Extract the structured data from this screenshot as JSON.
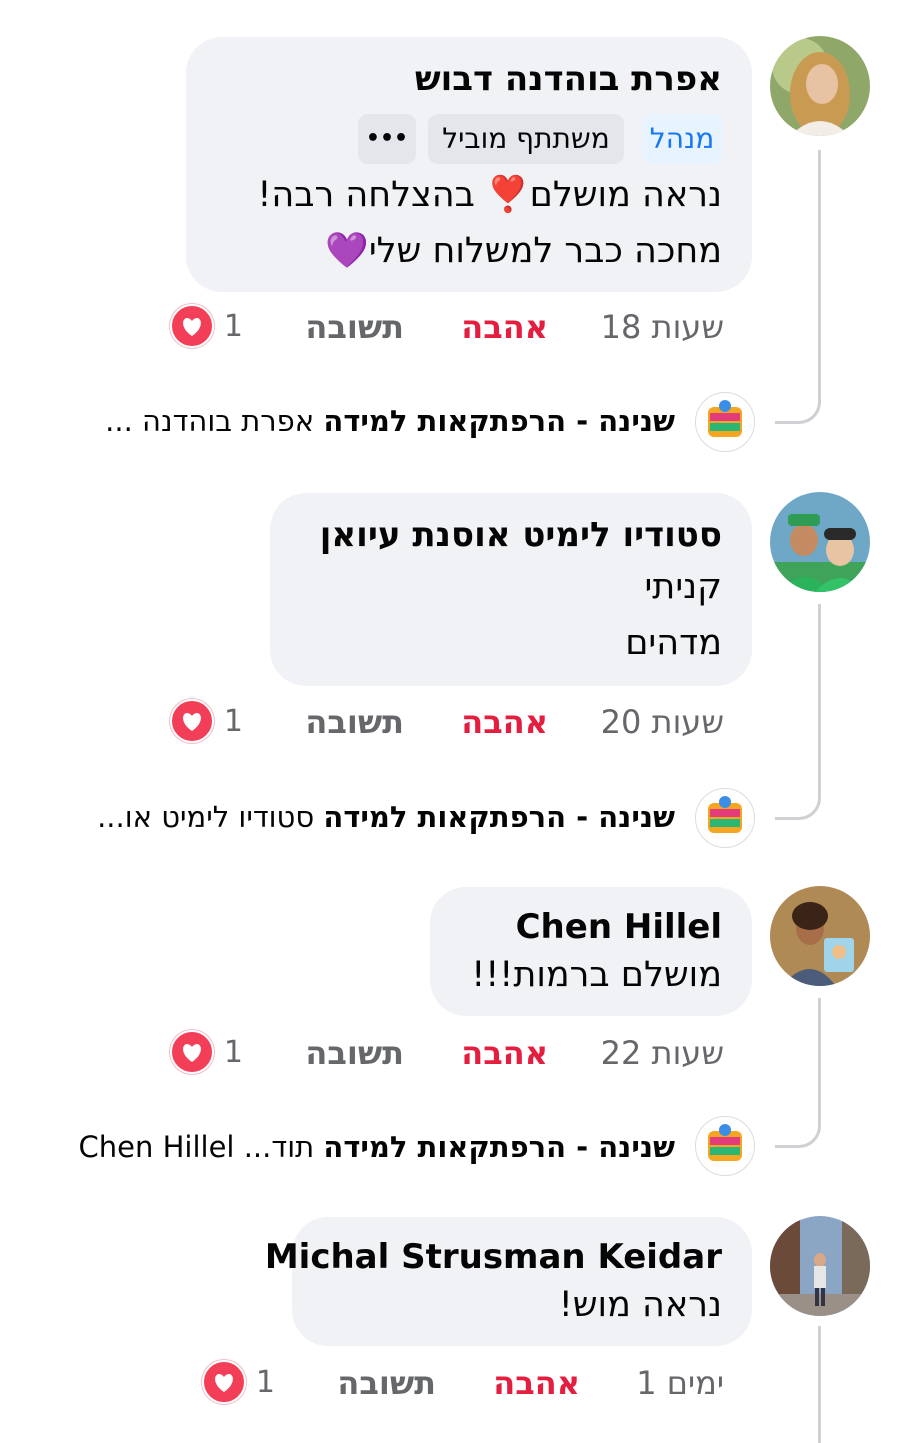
{
  "comments": [
    {
      "author": "אפרת בוהדנה דבוש",
      "badges": [
        "מנהל",
        "משתתף מוביל"
      ],
      "more": "•••",
      "lines": [
        "נראה מושלם❣️ בהצלחה רבה!",
        "מחכה כבר למשלוח שלי💜"
      ],
      "time": "18 שעות",
      "like": "אהבה",
      "reply": "תשובה",
      "reactions": "1",
      "reply_preview": {
        "author": "שנינה - הרפתקאות למידה",
        "text": "אפרת בוהדנה ..."
      }
    },
    {
      "author": "סטודיו לימיט אוסנת עיואן",
      "lines": [
        "קניתי",
        "מדהים"
      ],
      "time": "20 שעות",
      "like": "אהבה",
      "reply": "תשובה",
      "reactions": "1",
      "reply_preview": {
        "author": "שנינה - הרפתקאות למידה",
        "text": "סטודיו לימיט או..."
      }
    },
    {
      "author": "Chen Hillel",
      "lines": [
        "מושלם ברמות!!!"
      ],
      "time": "22 שעות",
      "like": "אהבה",
      "reply": "תשובה",
      "reactions": "1",
      "reply_preview": {
        "author": "שנינה - הרפתקאות למידה",
        "text": "תוד... Chen Hillel"
      }
    },
    {
      "author": "Michal Strusman Keidar",
      "lines": [
        "נראה מוש!"
      ],
      "time": "1 ימים",
      "like": "אהבה",
      "reply": "תשובה",
      "reactions": "1"
    }
  ],
  "colors": {
    "bubble": "#f0f2f5",
    "love": "#e41e3f",
    "meta": "#65676b",
    "admin_badge_bg": "#e7f3ff",
    "admin_badge_text": "#1877f2",
    "heart": "#f33e58"
  },
  "icons": [
    "heart-reaction-icon",
    "more-options-icon",
    "page-logo-icon"
  ]
}
